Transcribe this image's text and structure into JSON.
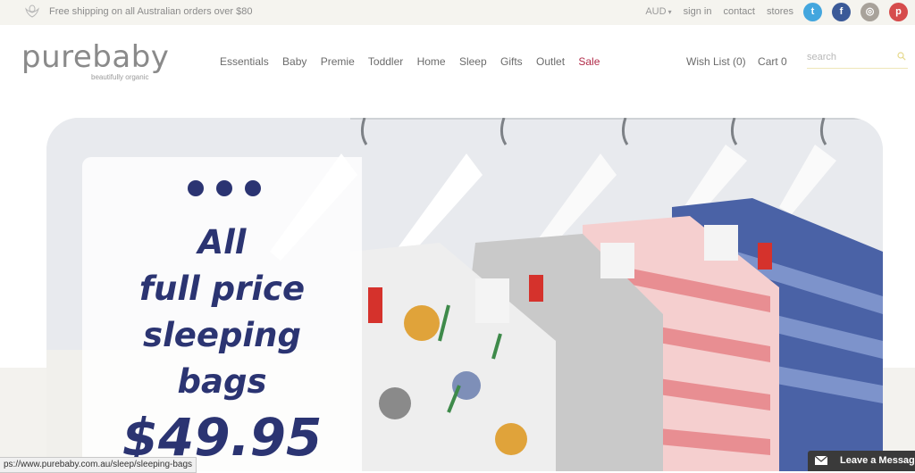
{
  "topbar": {
    "shipping": "Free shipping on all Australian orders over $80",
    "currency": "AUD",
    "links": [
      "sign in",
      "contact",
      "stores"
    ],
    "social": [
      {
        "name": "twitter-icon",
        "color": "#43a6de"
      },
      {
        "name": "facebook-icon",
        "color": "#3b5a98"
      },
      {
        "name": "instagram-icon",
        "color": "#a8a29a"
      },
      {
        "name": "pinterest-icon",
        "color": "#d64c4c"
      }
    ]
  },
  "header": {
    "logo": "purebaby",
    "tagline": "beautifully organic",
    "nav": [
      "Essentials",
      "Baby",
      "Premie",
      "Toddler",
      "Home",
      "Sleep",
      "Gifts",
      "Outlet",
      "Sale"
    ],
    "wishlist": "Wish List (0)",
    "cart": "Cart  0",
    "search_placeholder": "search"
  },
  "hero": {
    "line1": "All",
    "line2": "full price",
    "line3": "sleeping",
    "line4": "bags",
    "price": "$49.95",
    "accent": "#2b3472"
  },
  "status_url": "ps://www.purebaby.com.au/sleep/sleeping-bags",
  "chat": {
    "label": "Leave a Message"
  }
}
